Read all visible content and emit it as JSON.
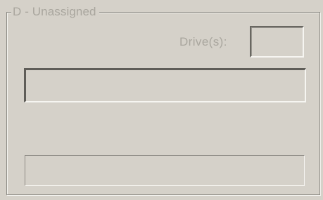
{
  "group": {
    "title": "D - Unassigned"
  },
  "drive": {
    "label": "Drive(s):",
    "value": ""
  },
  "main_field": {
    "value": ""
  },
  "status_field": {
    "value": ""
  }
}
